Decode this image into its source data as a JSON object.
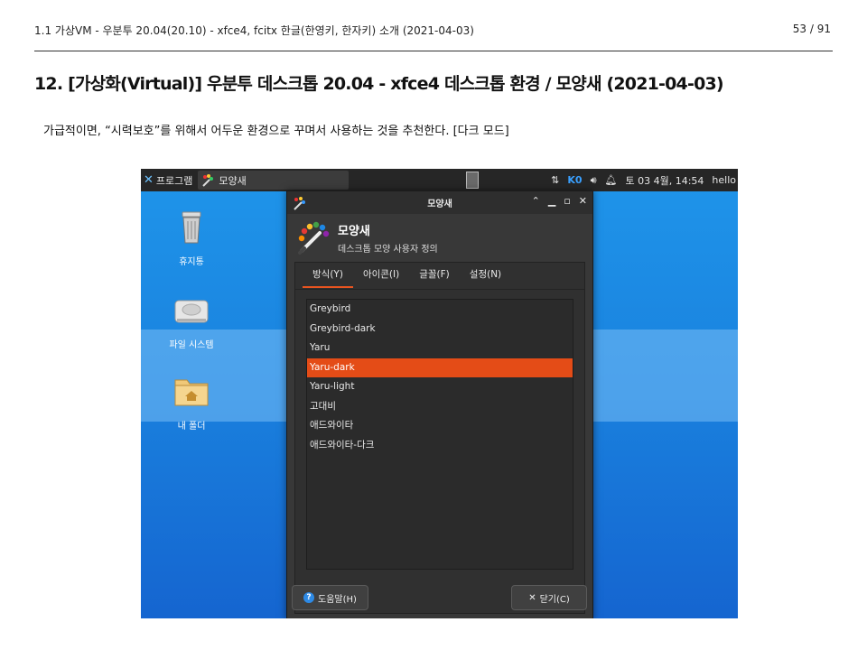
{
  "header": {
    "left": "1.1 가상VM - 우분투 20.04(20.10) - xfce4, fcitx 한글(한영키, 한자키) 소개 (2021-04-03)",
    "page": "53 / 91"
  },
  "title": "12. [가상화(Virtual)] 우분투 데스크톱 20.04 - xfce4 데스크톱 환경 / 모양새 (2021-04-03)",
  "description": "가급적이면, “시력보호”를 위해서 어두운 환경으로 꾸며서 사용하는 것을 추천한다. [다크 모드]",
  "screenshot": {
    "taskbar": {
      "menu_label": "프로그램",
      "task_label": "모양새",
      "input_indicator": "K0",
      "clock": "토 03 4월, 14:54",
      "user": "hello"
    },
    "desktop_icons": [
      {
        "label": "휴지통",
        "icon": "trash-icon"
      },
      {
        "label": "파일 시스템",
        "icon": "drive-icon"
      },
      {
        "label": "내 폴더",
        "icon": "home-folder-icon"
      }
    ],
    "dialog": {
      "window_title": "모양새",
      "app_name": "모양새",
      "app_subtitle": "데스크톱 모양 사용자 정의",
      "tabs": [
        "방식(Y)",
        "아이콘(I)",
        "글꼴(F)",
        "설정(N)"
      ],
      "active_tab": "방식(Y)",
      "themes": [
        "Greybird",
        "Greybird-dark",
        "Yaru",
        "Yaru-dark",
        "Yaru-light",
        "고대비",
        "애드와이타",
        "애드와이타-다크"
      ],
      "selected_theme": "Yaru-dark",
      "help_button": "도움말(H)",
      "close_button": "닫기(C)",
      "accent_color": "#e44c17"
    }
  }
}
